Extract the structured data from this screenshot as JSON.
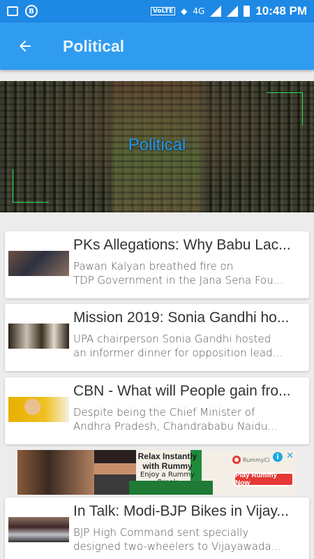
{
  "status_bar": {
    "volte": "VoLTE",
    "network": "4G",
    "time": "10:48 PM"
  },
  "app_bar": {
    "back_icon": "arrow-left-icon",
    "title": "Political"
  },
  "banner": {
    "title": "Political"
  },
  "articles": [
    {
      "title": "PKs Allegations: Why Babu Lac...",
      "desc_line1": "Pawan Kalyan breathed fire on",
      "desc_line2": "TDP Government in the Jana Sena Fou..."
    },
    {
      "title": "Mission 2019: Sonia Gandhi ho...",
      "desc_line1": "UPA chairperson Sonia Gandhi hosted",
      "desc_line2": "an informer dinner for opposition lead..."
    },
    {
      "title": "CBN - What will People gain fro...",
      "desc_line1": "Despite being the Chief Minister of",
      "desc_line2": "Andhra Pradesh, Chandrababu Naidu..."
    },
    {
      "title": "In Talk: Modi-BJP Bikes in Vijay...",
      "desc_line1": "BJP High Command sent specially",
      "desc_line2": "designed two-wheelers to Vijayawada..."
    }
  ],
  "ad": {
    "headline_1": "Relax Instantly",
    "headline_2": "with Rummy",
    "subline": "Enjoy a Rummy Break",
    "brand": "RummyCi",
    "button": "Play Rummy Now",
    "info": "i",
    "close": "✕"
  }
}
